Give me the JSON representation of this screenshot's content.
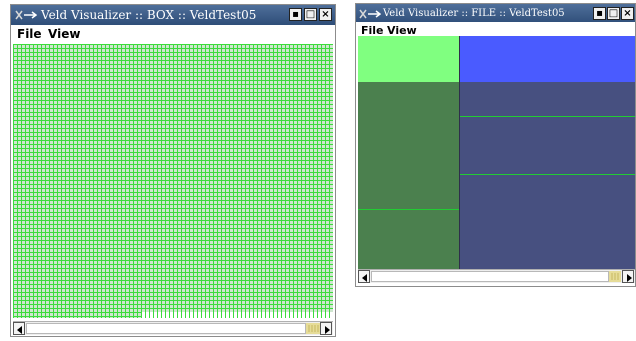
{
  "box_window": {
    "title": "Veld Visualizer :: BOX :: VeldTest05",
    "menu": [
      "File",
      "View"
    ]
  },
  "file_window": {
    "title": "Veld Visualizer :: FILE :: VeldTest05",
    "menu": [
      "File",
      "View"
    ]
  },
  "icons": {
    "minimize": "▪",
    "maximize": "□",
    "close": "×"
  },
  "colors": {
    "titlebar": "#3a5a88",
    "box_grid_line": "#3cdc3c",
    "box_grid_cell": "#cfe6cf",
    "file_light_green": "#80ff80",
    "file_dark_green": "#4b804e",
    "file_blue": "#4a5bff",
    "file_slate": "#475080",
    "file_divider": "#22cc33"
  }
}
